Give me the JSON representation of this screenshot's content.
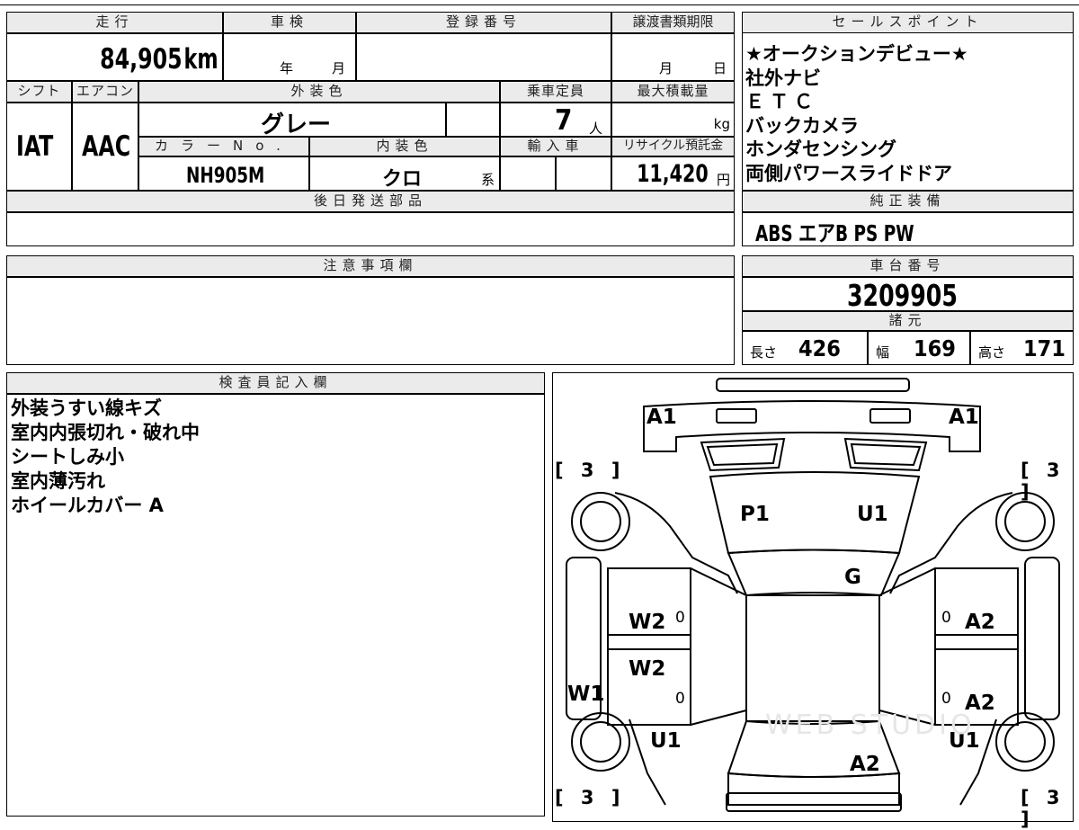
{
  "top": {
    "mileage_label": "走行",
    "mileage_value": "84,905",
    "mileage_unit": "km",
    "shaken_label": "車検",
    "shaken_year": "年",
    "shaken_month": "月",
    "reg_label": "登録番号",
    "transfer_label": "譲渡書類期限",
    "transfer_month": "月",
    "transfer_day": "日",
    "shift_label": "シフト",
    "shift_value": "IAT",
    "ac_label": "エアコン",
    "ac_value": "AAC",
    "ext_color_label": "外装色",
    "ext_color_value": "グレー",
    "capacity_label": "乗車定員",
    "capacity_value": "7",
    "capacity_unit": "人",
    "max_load_label": "最大積載量",
    "max_load_unit": "kg",
    "color_no_label": "カラーNo.",
    "color_no_value": "NH905M",
    "int_color_label": "内装色",
    "int_color_value": "クロ",
    "int_color_suffix": "系",
    "import_label": "輸入車",
    "recycle_label": "リサイクル預託金",
    "recycle_value": "11,420",
    "recycle_unit": "円",
    "later_parts_label": "後日発送部品"
  },
  "sales": {
    "label": "セールスポイント",
    "lines": [
      "★オークションデビュー★",
      "社外ナビ",
      "ＥＴＣ",
      "バックカメラ",
      "ホンダセンシング",
      "両側パワースライドドア"
    ]
  },
  "genuine": {
    "label": "純正装備",
    "value": "ABS エアB PS PW"
  },
  "notes": {
    "label": "注意事項欄"
  },
  "chassis": {
    "label": "車台番号",
    "value": "3209905"
  },
  "specs": {
    "label": "諸元",
    "length_label": "長さ",
    "length_value": "426",
    "width_label": "幅",
    "width_value": "169",
    "height_label": "高さ",
    "height_value": "171"
  },
  "inspector": {
    "label": "検査員記入欄",
    "lines": [
      "外装うすい線キズ",
      "室内内張切れ・破れ中",
      "シートしみ小",
      "室内薄汚れ",
      "ホイールカバー A"
    ]
  },
  "diagram": {
    "marks": {
      "a1_left": "A1",
      "a1_right": "A1",
      "p1": "P1",
      "u1_top": "U1",
      "g": "G",
      "w2_upper": "W2",
      "w2_lower": "W2",
      "w1": "W1",
      "a2_upper": "A2",
      "a2_lower": "A2",
      "a2_rear": "A2",
      "u1_left": "U1",
      "u1_right": "U1",
      "zero_1": "0",
      "zero_2": "0",
      "zero_3": "0",
      "zero_4": "0"
    },
    "tire_tl": "[ 3 ]",
    "tire_tr": "[ 3 ]",
    "tire_bl": "[ 3 ]",
    "tire_br": "[ 3 ]",
    "watermark": "WEB STUDIO"
  }
}
